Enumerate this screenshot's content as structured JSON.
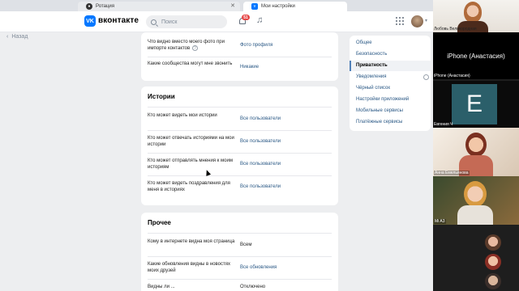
{
  "browser": {
    "tabs": [
      {
        "label": "Ротация",
        "icon": "record-icon"
      },
      {
        "label": "Мои настройки",
        "icon": "vk-icon"
      }
    ]
  },
  "header": {
    "logo_letter": "VK",
    "brand": "вконтакте",
    "search_placeholder": "Поиск",
    "notifications_count": "51"
  },
  "nav": {
    "back_label": "Назад"
  },
  "privacy_top": {
    "rows": [
      {
        "question": "Что видно вместо моего фото при импорте контактов",
        "value": "Фото профиля"
      },
      {
        "question": "Какие сообщества могут мне звонить",
        "value": "Никакие"
      }
    ]
  },
  "stories": {
    "title": "Истории",
    "rows": [
      {
        "question": "Кто может видеть мои истории",
        "value": "Все пользователи"
      },
      {
        "question": "Кто может отвечать историями на мои истории",
        "value": "Все пользователи"
      },
      {
        "question": "Кто может отправлять мнения к моим историям",
        "value": "Все пользователи"
      },
      {
        "question": "Кто может видеть поздравления для меня в историях",
        "value": "Все пользователи"
      }
    ]
  },
  "other": {
    "title": "Прочее",
    "rows": [
      {
        "question": "Кому в интернете видна моя страница",
        "value": "Всем"
      },
      {
        "question": "Какие обновления видны в новостях моих друзей",
        "value": "Все обновления"
      },
      {
        "question": "Видны ли ...",
        "value": "Отключено"
      }
    ]
  },
  "settings_menu": {
    "items": [
      {
        "label": "Общее",
        "active": false
      },
      {
        "label": "Безопасность",
        "active": false
      },
      {
        "label": "Приватность",
        "active": true
      },
      {
        "label": "Уведомления",
        "active": false
      },
      {
        "label": "Чёрный список",
        "active": false
      },
      {
        "label": "Настройки приложений",
        "active": false
      },
      {
        "label": "Мобильные сервисы",
        "active": false
      },
      {
        "label": "Платёжные сервисы",
        "active": false
      }
    ]
  },
  "video_call": {
    "participants": [
      {
        "label": "Любовь Великородная"
      },
      {
        "label": "iPhone (Анастасия)",
        "center_text": "iPhone (Анастасия)"
      },
      {
        "label": "Евгения Ч",
        "initial": "E"
      },
      {
        "label": "Анна Емельянова"
      },
      {
        "label": "Mi A3"
      }
    ]
  },
  "colors": {
    "accent": "#0077ff",
    "link": "#2a5885",
    "badge": "#e64646",
    "page_bg": "#edeef0"
  }
}
